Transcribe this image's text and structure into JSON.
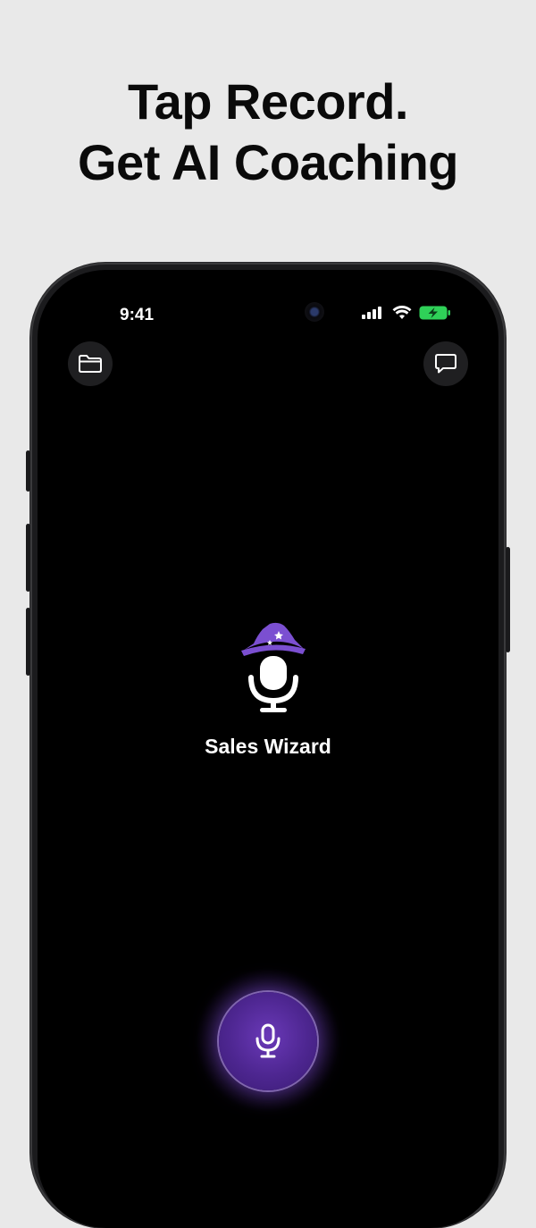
{
  "headline": {
    "line1": "Tap Record.",
    "line2": "Get AI Coaching"
  },
  "status_bar": {
    "time": "9:41",
    "icons": [
      "cellular-icon",
      "wifi-icon",
      "battery-charging-icon"
    ]
  },
  "toolbar": {
    "left_icon": "folder-icon",
    "right_icon": "chat-bubble-icon"
  },
  "app": {
    "name": "Sales Wizard",
    "logo_icon": "wizard-hat-microphone-icon"
  },
  "record_button": {
    "icon": "microphone-icon"
  },
  "colors": {
    "accent": "#6a39b8",
    "hat": "#7b4fd1",
    "battery": "#2fd158",
    "screen_bg": "#000000",
    "page_bg": "#e9e9e9"
  }
}
